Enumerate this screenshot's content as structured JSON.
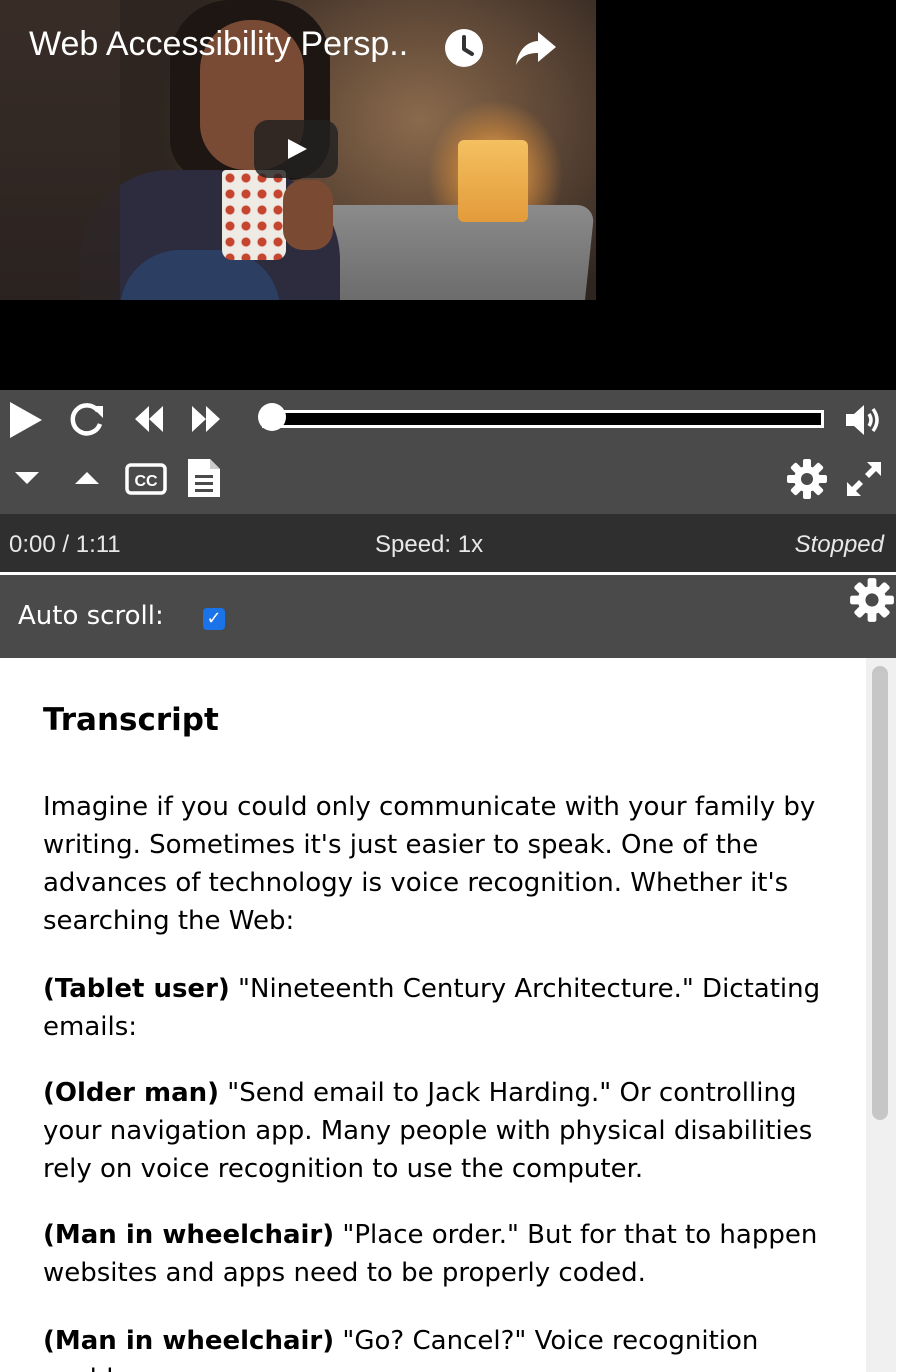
{
  "video": {
    "title": "Web Accessibility Persp..",
    "watch_later_icon": "clock-icon",
    "share_icon": "share-arrow-icon",
    "play_icon": "youtube-play-icon"
  },
  "controls": {
    "play_icon": "play-icon",
    "restart_icon": "restart-icon",
    "rewind_icon": "rewind-icon",
    "forward_icon": "fast-forward-icon",
    "volume_icon": "volume-icon",
    "slower_icon": "caret-down-icon",
    "faster_icon": "caret-up-icon",
    "captions_icon": "closed-captions-icon",
    "transcript_icon": "document-icon",
    "settings_icon": "gear-icon",
    "fullscreen_icon": "fullscreen-icon",
    "seek_progress": 0
  },
  "status": {
    "time": "0:00 / 1:11",
    "speed": "Speed: 1x",
    "state": "Stopped"
  },
  "transcript_toolbar": {
    "autoscroll_label": "Auto scroll:",
    "autoscroll_checked": true,
    "settings_icon": "gear-icon"
  },
  "transcript": {
    "title": "Transcript",
    "paragraphs": [
      {
        "speaker": "",
        "text": "Imagine if you could only communicate with your family by writing. Sometimes it's just easier to speak. One of the advances of technology is voice recognition. Whether it's searching the Web:"
      },
      {
        "speaker": "(Tablet user)",
        "text": " \"Nineteenth Century Architecture.\" Dictating emails:"
      },
      {
        "speaker": "(Older man)",
        "text": " \"Send email to Jack Harding.\" Or controlling your navigation app. Many people with physical disabilities rely on voice recognition to use the computer."
      },
      {
        "speaker": "(Man in wheelchair)",
        "text": " \"Place order.\" But for that to happen websites and apps need to be properly coded."
      },
      {
        "speaker": "(Man in wheelchair)",
        "text": " \"Go? Cancel?\" Voice recognition could"
      }
    ]
  },
  "colors": {
    "control_bg": "#4a4a4a",
    "status_bg": "#2f2f2f",
    "checkbox": "#1a73e8"
  }
}
